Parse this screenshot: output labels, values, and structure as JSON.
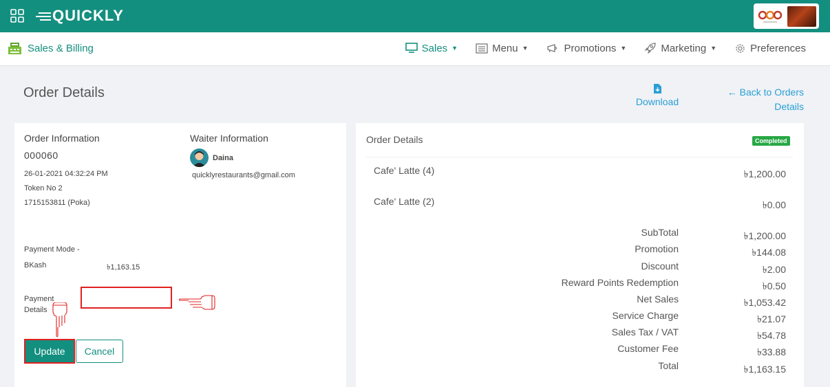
{
  "app": {
    "logo_text": "QUICKLY",
    "module_label": "Sales & Billing",
    "nav": [
      {
        "label": "Sales"
      },
      {
        "label": "Menu"
      },
      {
        "label": "Promotions"
      },
      {
        "label": "Marketing"
      },
      {
        "label": "Preferences"
      }
    ],
    "colors": {
      "brand": "#138f7f",
      "link": "#2a9fd6",
      "highlight": "#e02020",
      "badge": "#28a745"
    }
  },
  "page": {
    "title": "Order Details",
    "download_label": "Download",
    "back_label": "Back to Orders Details"
  },
  "order_info": {
    "title": "Order Information",
    "number": "000060",
    "datetime": "26-01-2021 04:32:24 PM",
    "token": "Token No 2",
    "customer": "1715153811 (Poka)",
    "payment_mode_label": "Payment Mode -",
    "payment_method": "BKash",
    "payment_amount": "৳1,163.15",
    "payment_details_label": "Payment Details",
    "payment_details_value": "",
    "update_label": "Update",
    "cancel_label": "Cancel"
  },
  "waiter": {
    "title": "Waiter Information",
    "name": "Daina",
    "email": "quicklyrestaurants@gmail.com"
  },
  "order_details": {
    "title": "Order Details",
    "status": "Completed",
    "items": [
      {
        "name": "Cafe' Latte (4)",
        "price": "৳1,200.00"
      },
      {
        "name": "Cafe' Latte (2)",
        "price": "৳0.00"
      }
    ],
    "summary": [
      {
        "label": "SubTotal",
        "value": "৳1,200.00"
      },
      {
        "label": "Promotion",
        "value": "৳144.08"
      },
      {
        "label": "Discount",
        "value": "৳2.00"
      },
      {
        "label": "Reward Points Redemption",
        "value": "৳0.50"
      },
      {
        "label": "Net Sales",
        "value": "৳1,053.42"
      },
      {
        "label": "Service Charge",
        "value": "৳21.07"
      },
      {
        "label": "Sales Tax / VAT",
        "value": "৳54.78"
      },
      {
        "label": "Customer Fee",
        "value": "৳33.88"
      },
      {
        "label": "Total",
        "value": "৳1,163.15"
      }
    ]
  }
}
